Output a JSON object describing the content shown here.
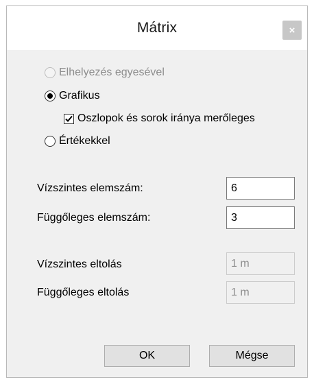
{
  "window": {
    "title": "Mátrix",
    "close_label": "×"
  },
  "options": {
    "one_by_one": {
      "label": "Elhelyezés egyesével",
      "selected": false,
      "enabled": false
    },
    "graphic": {
      "label": "Grafikus",
      "selected": true,
      "enabled": true
    },
    "perpendicular": {
      "label": "Oszlopok és sorok iránya merőleges",
      "checked": true
    },
    "by_values": {
      "label": "Értékekkel",
      "selected": false,
      "enabled": true
    }
  },
  "fields": {
    "horizontal_count": {
      "label": "Vízszintes elemszám:",
      "value": "6"
    },
    "vertical_count": {
      "label": "Függőleges elemszám:",
      "value": "3"
    },
    "horizontal_offset": {
      "label": "Vízszintes eltolás",
      "value": "1 m"
    },
    "vertical_offset": {
      "label": "Függőleges eltolás",
      "value": "1 m"
    }
  },
  "buttons": {
    "ok": "OK",
    "cancel": "Mégse"
  }
}
